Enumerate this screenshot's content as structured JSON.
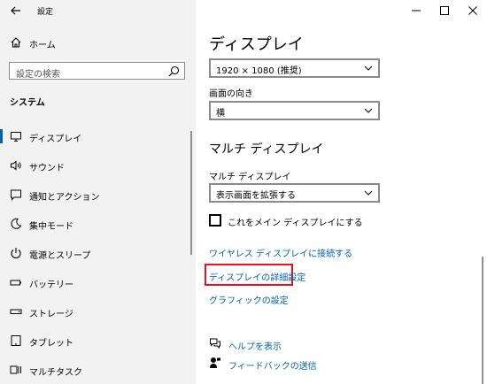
{
  "window": {
    "title": "設定"
  },
  "sidebar": {
    "home_label": "ホーム",
    "search_placeholder": "設定の検索",
    "section_title": "システム",
    "items": [
      {
        "label": "ディスプレイ",
        "icon": "monitor-icon",
        "active": true
      },
      {
        "label": "サウンド",
        "icon": "speaker-icon",
        "active": false
      },
      {
        "label": "通知とアクション",
        "icon": "notification-icon",
        "active": false
      },
      {
        "label": "集中モード",
        "icon": "moon-icon",
        "active": false
      },
      {
        "label": "電源とスリープ",
        "icon": "power-icon",
        "active": false
      },
      {
        "label": "バッテリー",
        "icon": "battery-icon",
        "active": false
      },
      {
        "label": "ストレージ",
        "icon": "storage-icon",
        "active": false
      },
      {
        "label": "タブレット",
        "icon": "tablet-icon",
        "active": false
      },
      {
        "label": "マルチタスク",
        "icon": "multitask-icon",
        "active": false
      }
    ]
  },
  "main": {
    "page_title": "ディスプレイ",
    "resolution_value": "1920 × 1080 (推奨)",
    "orientation_label": "画面の向き",
    "orientation_value": "横",
    "multi_display_heading": "マルチ ディスプレイ",
    "multi_display_label": "マルチ ディスプレイ",
    "multi_display_value": "表示画面を拡張する",
    "main_display_checkbox": "これをメイン ディスプレイにする",
    "links": {
      "wireless": "ワイヤレス ディスプレイに接続する",
      "advanced": "ディスプレイの詳細設定",
      "graphics": "グラフィックの設定"
    },
    "help": {
      "get_help": "ヘルプを表示",
      "feedback": "フィードバックの送信"
    }
  },
  "colors": {
    "accent": "#0063b1",
    "highlight": "#e81123",
    "sidebar_bg": "#f2f2f2"
  }
}
